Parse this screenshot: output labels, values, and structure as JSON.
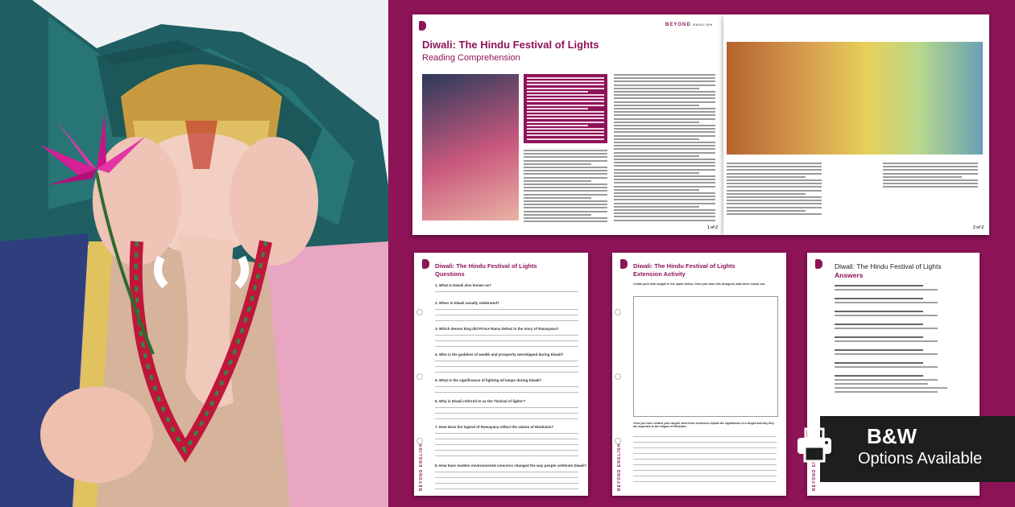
{
  "brand": {
    "name": "BEYOND",
    "suffix": "ENGLISH",
    "vertical": "BEYOND ENGLISH"
  },
  "main_sheet": {
    "title": "Diwali: The Hindu Festival of Lights",
    "subtitle": "Reading Comprehension",
    "page_left": "1 of 2",
    "page_right": "2 of 2"
  },
  "questions_sheet": {
    "title": "Diwali: The Hindu Festival of Lights",
    "subtitle": "Questions",
    "items": [
      "1. What is Diwali also known as?",
      "2. When is Diwali usually celebrated?",
      "3. Which demon king did Prince Rama defeat in the story of Ramayana?",
      "4. Who is the goddess of wealth and prosperity worshipped during Diwali?",
      "5. What is the significance of lighting oil lamps during Diwali?",
      "6. Why is Diwali referred to as the 'festival of lights'?",
      "7. How does the legend of Ramayana reflect the values of Hinduism?",
      "8. How have modern environmental concerns changed the way people celebrate Diwali?"
    ]
  },
  "extension_sheet": {
    "title": "Diwali: The Hindu Festival of Lights",
    "subtitle": "Extension Activity",
    "instruction": "Create your own rangoli in the space below. Once you have this designed, add some colour too.",
    "footer_instruction": "Once you have created your rangoli, write three sentences explain the significance of a rangoli and why they are important to the religion of Hinduism."
  },
  "answers_sheet": {
    "title": "Diwali: The Hindu Festival of Lights",
    "subtitle": "Answers"
  },
  "badge": {
    "line1": "B&W",
    "line2": "Options Available",
    "icon": "printer-icon"
  },
  "colors": {
    "brand": "#8e1458",
    "badge_bg": "#1e1e1e"
  }
}
